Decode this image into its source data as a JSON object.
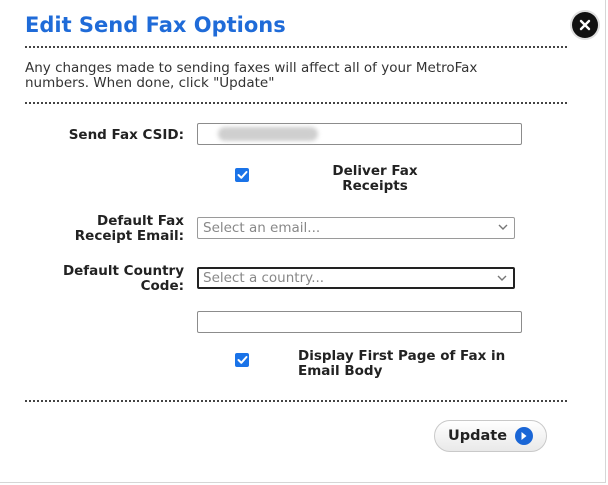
{
  "dialog": {
    "title": "Edit Send Fax Options",
    "intro_line1": "Any changes made to sending faxes will affect all of your MetroFax",
    "intro_line2": "numbers. When done, click \"Update\""
  },
  "form": {
    "csid_label": "Send Fax CSID:",
    "csid_value": "",
    "deliver_receipts_label_1": "Deliver Fax",
    "deliver_receipts_label_2": "Receipts",
    "deliver_receipts_checked": true,
    "receipt_email_label_1": "Default Fax",
    "receipt_email_label_2": "Receipt Email:",
    "receipt_email_placeholder": "Select an email...",
    "country_code_label_1": "Default Country",
    "country_code_label_2": "Code:",
    "country_code_placeholder": "Select a country...",
    "extra_field_value": "",
    "display_first_page_label_1": "Display First Page of Fax in",
    "display_first_page_label_2": "Email Body",
    "display_first_page_checked": true
  },
  "actions": {
    "update_label": "Update"
  },
  "icons": {
    "close": "close-icon",
    "check": "checkmark-icon",
    "chevron": "chevron-down-icon",
    "arrow": "arrow-right-circle-icon"
  },
  "colors": {
    "title": "#1f6bd8",
    "checkbox": "#1a73e8",
    "update_arrow": "#1a66d6"
  }
}
